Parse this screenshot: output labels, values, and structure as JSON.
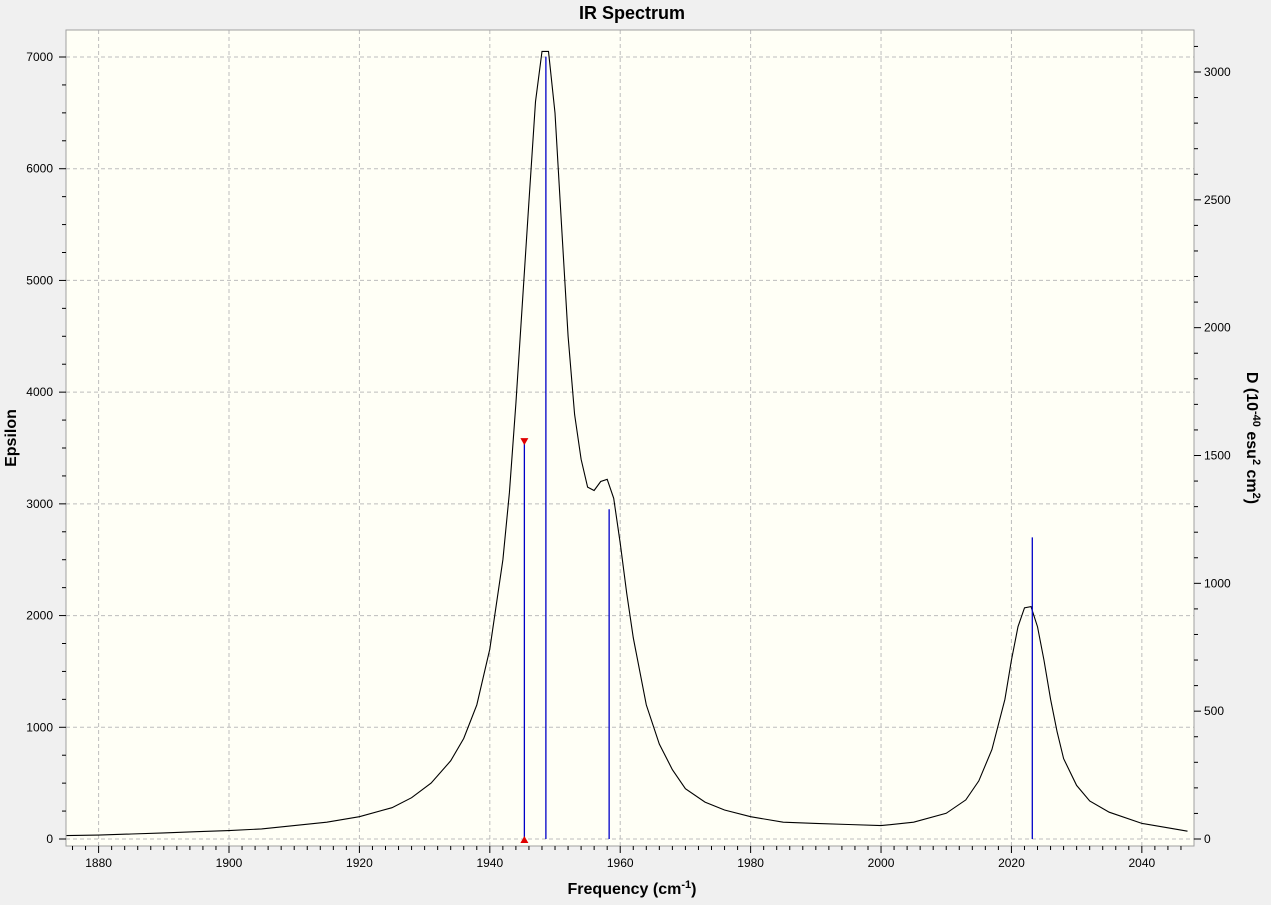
{
  "chart_data": {
    "type": "line",
    "title": "IR Spectrum",
    "xlabel": {
      "main": "Frequency (cm",
      "sup": "-1",
      "tail": ")"
    },
    "ylabel_left": "Epsilon",
    "ylabel_right": {
      "p1": "D (10",
      "s1": "-40",
      "p2": " esu",
      "s2": "2",
      "p3": " cm",
      "s3": "2",
      "p4": ")"
    },
    "xlim": [
      1875,
      2048
    ],
    "ylim_left": [
      0,
      7300
    ],
    "ylim_right": [
      0,
      3125
    ],
    "x_ticks": [
      1880,
      1900,
      1920,
      1940,
      1960,
      1980,
      2000,
      2020,
      2040
    ],
    "y_ticks_left": [
      0,
      1000,
      2000,
      3000,
      4000,
      5000,
      6000,
      7000
    ],
    "y_ticks_right": [
      0,
      500,
      1000,
      1500,
      2000,
      2500,
      3000
    ],
    "grid": true,
    "colors": {
      "plot_bg": "#fffff6",
      "outer_bg": "#f0f0f0",
      "curve": "#000000",
      "sticks": "#0000c8",
      "marker": "#e00000",
      "grid": "#bdbdbd"
    },
    "series": [
      {
        "x": [
          1875,
          1880,
          1885,
          1890,
          1895,
          1900,
          1905,
          1910,
          1915,
          1920,
          1925,
          1928,
          1931,
          1934,
          1936,
          1938,
          1940,
          1942,
          1943,
          1944,
          1945,
          1946,
          1947,
          1948,
          1949,
          1950,
          1951,
          1952,
          1953,
          1954,
          1955,
          1956,
          1957,
          1958,
          1959,
          1960,
          1961,
          1962,
          1964,
          1966,
          1968,
          1970,
          1973,
          1976,
          1980,
          1985,
          1990,
          1995,
          2000,
          2005,
          2010,
          2013,
          2015,
          2017,
          2019,
          2020,
          2021,
          2022,
          2023,
          2024,
          2025,
          2026,
          2027,
          2028,
          2030,
          2032,
          2035,
          2040,
          2044,
          2047
        ],
        "y": [
          30,
          35,
          45,
          55,
          65,
          75,
          90,
          120,
          150,
          200,
          280,
          370,
          500,
          700,
          900,
          1200,
          1700,
          2500,
          3100,
          3900,
          4800,
          5700,
          6600,
          7050,
          7050,
          6500,
          5500,
          4500,
          3800,
          3400,
          3150,
          3120,
          3200,
          3220,
          3050,
          2650,
          2200,
          1800,
          1200,
          850,
          620,
          450,
          330,
          260,
          200,
          150,
          140,
          130,
          120,
          150,
          230,
          350,
          520,
          800,
          1250,
          1600,
          1900,
          2070,
          2080,
          1900,
          1600,
          1250,
          960,
          720,
          480,
          340,
          240,
          140,
          100,
          70
        ]
      }
    ],
    "sticks": [
      {
        "x": 1945.3,
        "d": 1560
      },
      {
        "x": 1948.6,
        "d": 3060
      },
      {
        "x": 1958.3,
        "d": 1290
      },
      {
        "x": 2023.2,
        "d": 1180
      }
    ],
    "marker": {
      "x": 1945.3,
      "d": 1560
    }
  }
}
